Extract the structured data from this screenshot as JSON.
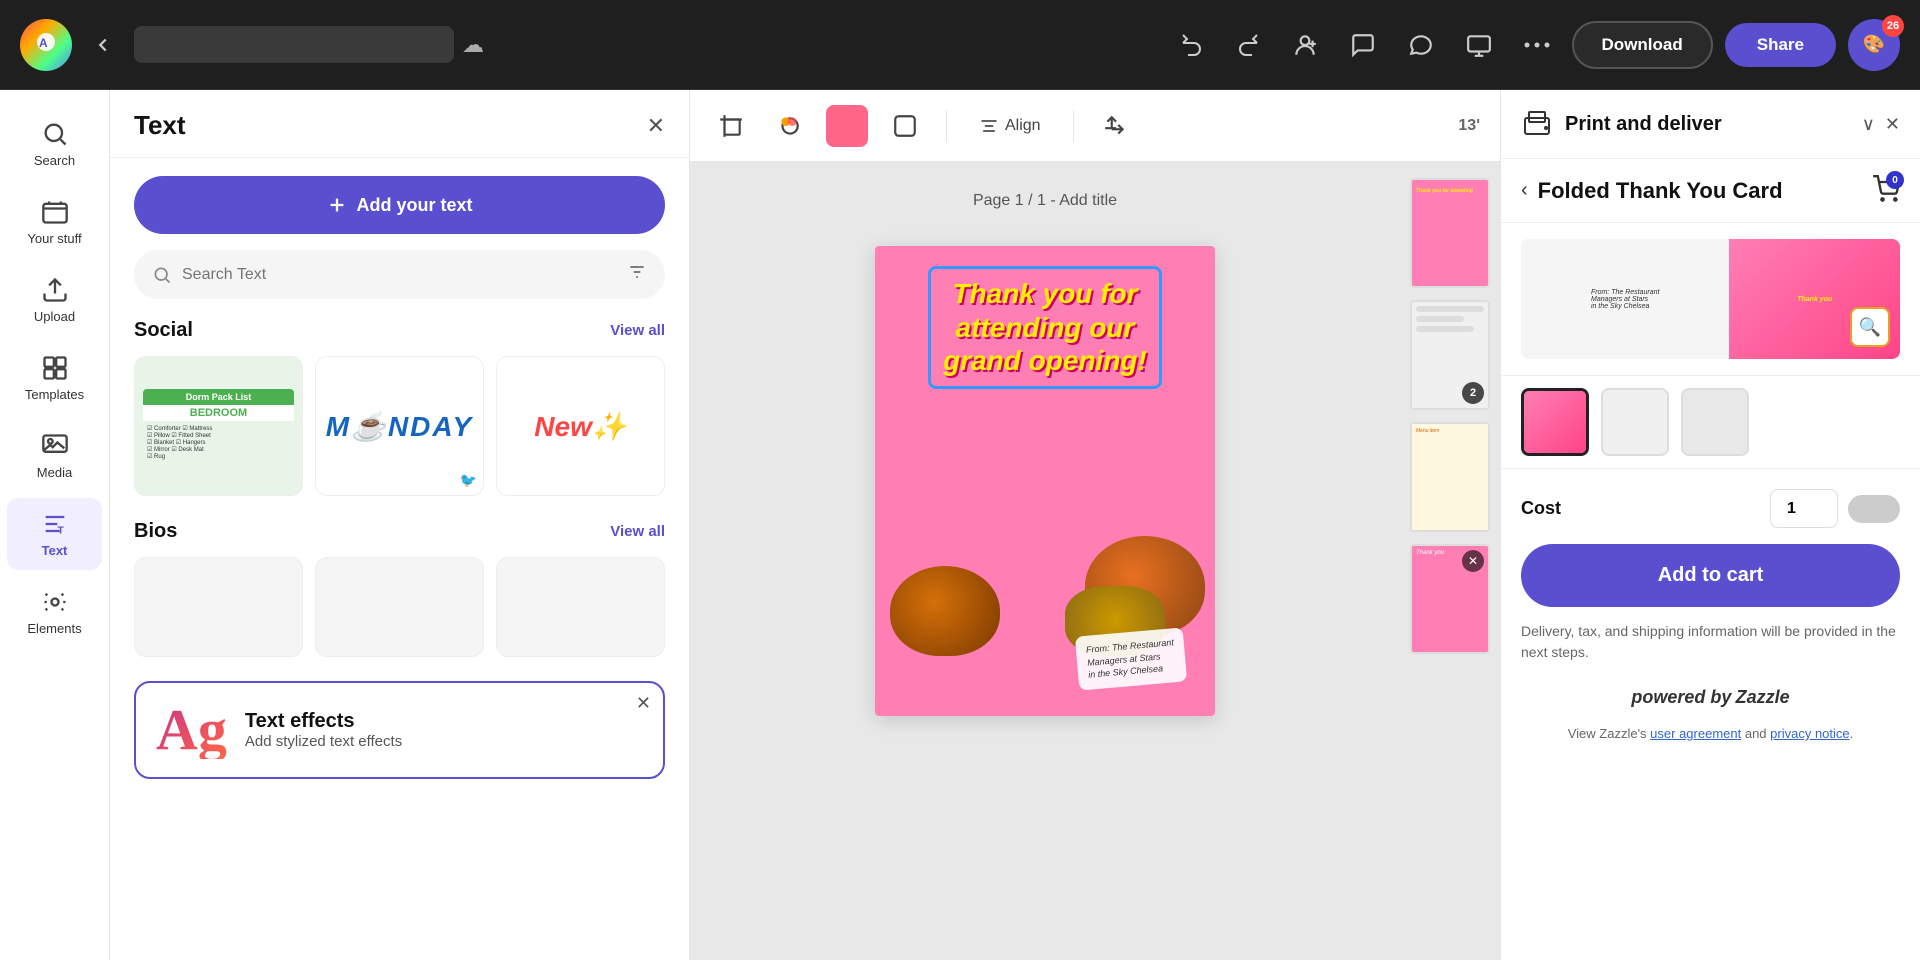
{
  "topbar": {
    "undo_title": "Undo",
    "redo_title": "Redo",
    "add_collaborator_title": "Add collaborator",
    "comments_title": "Comments",
    "chat_title": "Chat",
    "present_title": "Present",
    "more_title": "More",
    "download_label": "Download",
    "share_label": "Share",
    "avatar_badge": "26"
  },
  "sidebar": {
    "items": [
      {
        "id": "search",
        "label": "Search",
        "icon": "search"
      },
      {
        "id": "your-stuff",
        "label": "Your stuff",
        "icon": "folder"
      },
      {
        "id": "upload",
        "label": "Upload",
        "icon": "upload"
      },
      {
        "id": "templates",
        "label": "Templates",
        "icon": "grid"
      },
      {
        "id": "media",
        "label": "Media",
        "icon": "media"
      },
      {
        "id": "text",
        "label": "Text",
        "icon": "text",
        "active": true
      },
      {
        "id": "elements",
        "label": "Elements",
        "icon": "elements"
      }
    ]
  },
  "text_panel": {
    "title": "Text",
    "add_text_label": "Add your text",
    "search_placeholder": "Search Text",
    "social_section": "Social",
    "view_all_label": "View all",
    "bios_section": "Bios",
    "text_effects": {
      "title": "Text effects",
      "description": "Add stylized text effects"
    }
  },
  "canvas": {
    "page_label": "Page 1 / 1 - Add title",
    "align_label": "Align",
    "canvas_text": "Thank you for attending our grand opening!",
    "signature_text": "From: The Restaurant\nManagers at Stars\nin the Sky Chelsea"
  },
  "print_panel": {
    "title": "Print and deliver",
    "product_title": "Folded Thank You Card",
    "back_label": "<",
    "cart_badge": "0",
    "cost_label": "Cost",
    "quantity": "1",
    "add_to_cart_label": "Add to cart",
    "delivery_info": "Delivery, tax, and shipping information will be provided in the next steps.",
    "powered_by": "powered by",
    "zazzle_label": "Zazzle",
    "zazzle_links": "View Zazzle's user agreement and privacy notice."
  }
}
